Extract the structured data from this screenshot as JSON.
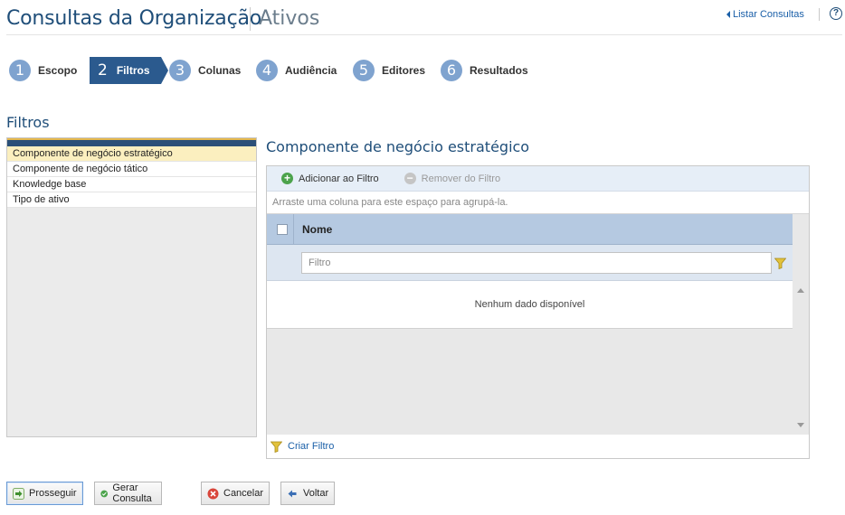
{
  "header": {
    "title": "Consultas da Organização",
    "subtitle": "Ativos",
    "list_link": "Listar Consultas",
    "help_icon": "?"
  },
  "steps": [
    {
      "num": "1",
      "label": "Escopo"
    },
    {
      "num": "2",
      "label": "Filtros",
      "active": true
    },
    {
      "num": "3",
      "label": "Colunas"
    },
    {
      "num": "4",
      "label": "Audiência"
    },
    {
      "num": "5",
      "label": "Editores"
    },
    {
      "num": "6",
      "label": "Resultados"
    }
  ],
  "filters": {
    "title": "Filtros",
    "items": [
      "Componente de negócio estratégico",
      "Componente de negócio tático",
      "Knowledge base",
      "Tipo de ativo"
    ],
    "selected_index": 0
  },
  "panel": {
    "title": "Componente de negócio estratégico",
    "toolbar": {
      "add_label": "Adicionar ao Filtro",
      "remove_label": "Remover do Filtro"
    },
    "group_hint": "Arraste uma coluna para este espaço para agrupá-la.",
    "column_header": "Nome",
    "filter_placeholder": "Filtro",
    "no_data": "Nenhum dado disponível",
    "create_filter": "Criar Filtro"
  },
  "buttons": {
    "proceed": "Prosseguir",
    "generate": "Gerar Consulta",
    "cancel": "Cancelar",
    "back": "Voltar"
  },
  "colors": {
    "brand": "#1f4e79",
    "active_step": "#2b5a8e",
    "step_circle": "#7fa3cf",
    "selected_row": "#fbefbf",
    "link": "#1a5fa8"
  }
}
